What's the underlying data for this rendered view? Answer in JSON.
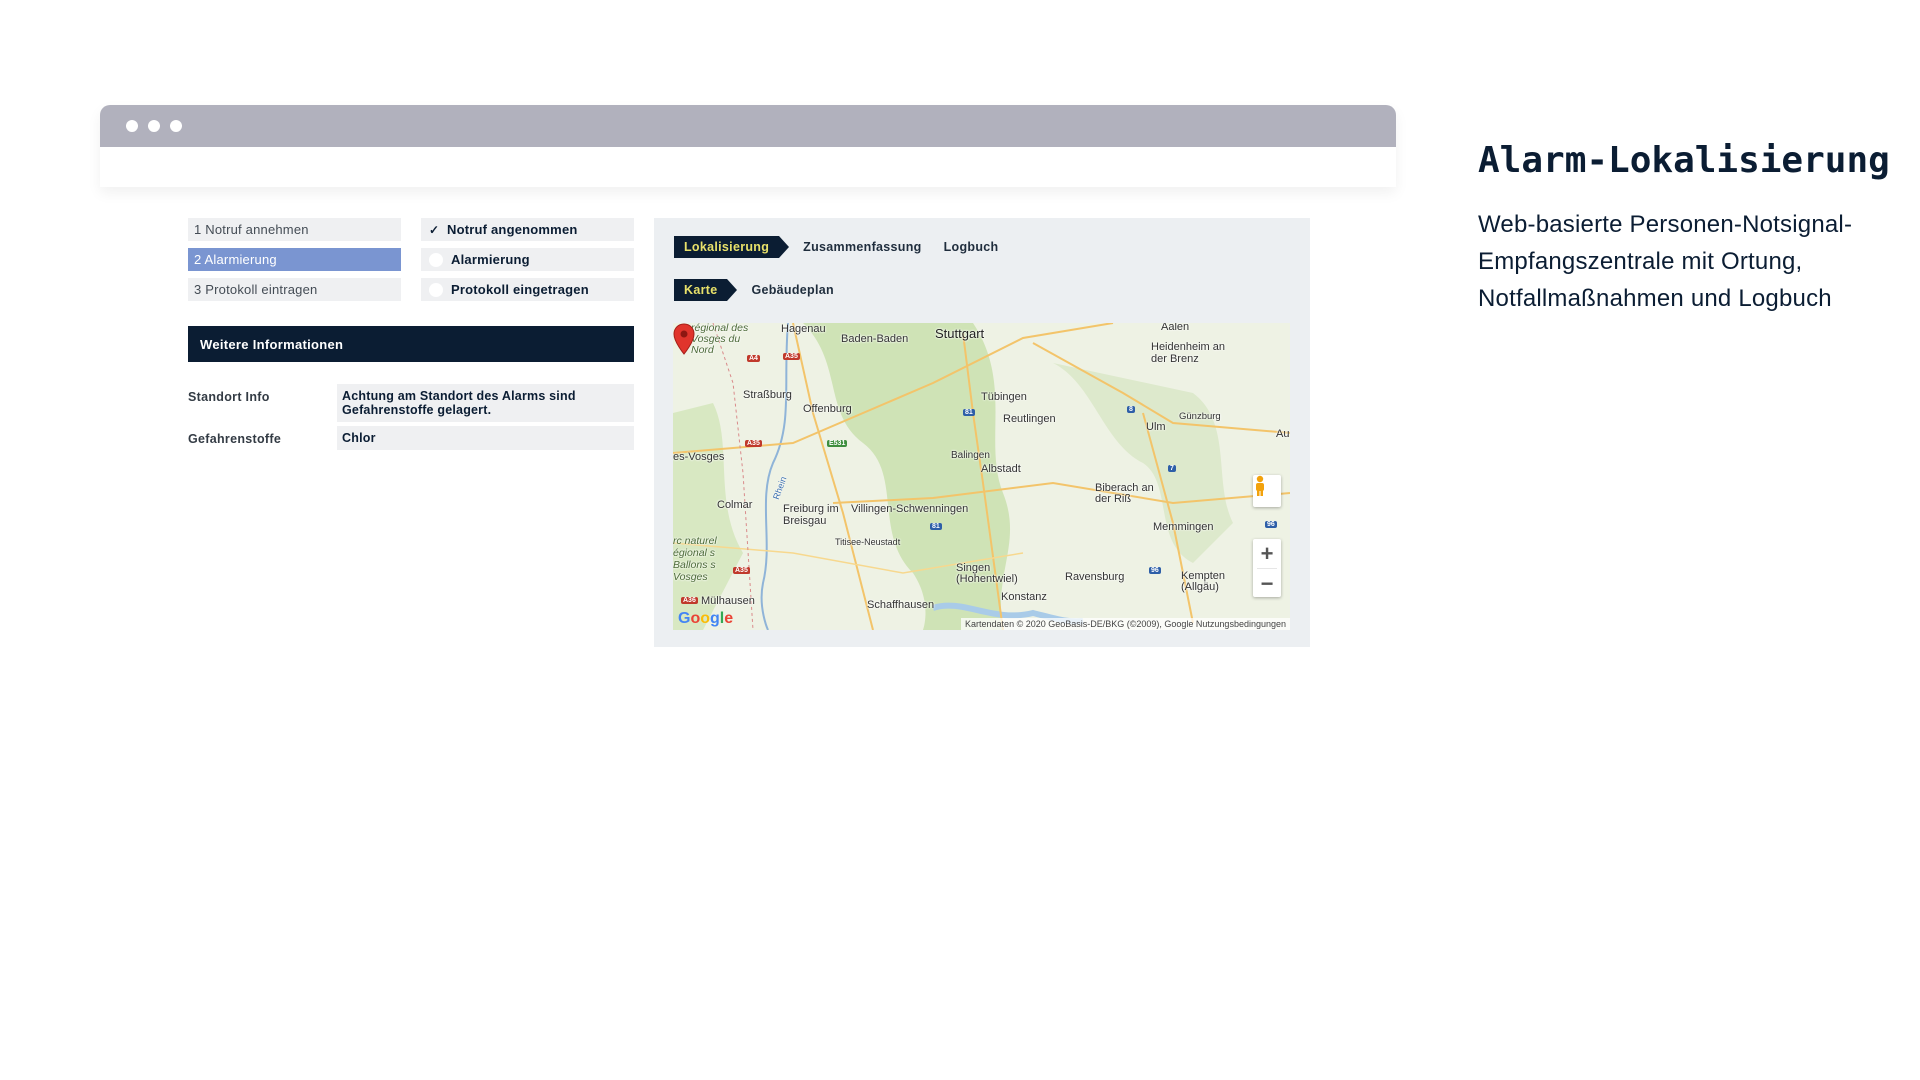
{
  "steps": [
    {
      "label": "1 Notruf annehmen",
      "status_label": "Notruf angenommen",
      "status": "done",
      "active": false
    },
    {
      "label": "2 Alarmierung",
      "status_label": "Alarmierung",
      "status": "pending",
      "active": true
    },
    {
      "label": "3 Protokoll eintragen",
      "status_label": "Protokoll eingetragen",
      "status": "pending",
      "active": false
    }
  ],
  "info": {
    "header": "Weitere Informationen",
    "fields": [
      {
        "label": "Standort Info",
        "value": "Achtung am Standort des Alarms sind Gefahrenstoffe gelagert."
      },
      {
        "label": "Gefahrenstoffe",
        "value": "Chlor"
      }
    ]
  },
  "tabs_main": {
    "active": "Lokalisierung",
    "others": [
      "Zusammenfassung",
      "Logbuch"
    ]
  },
  "tabs_sub": {
    "active": "Karte",
    "others": [
      "Gebäudeplan"
    ]
  },
  "map": {
    "labels": {
      "stuttgart": "Stuttgart",
      "baden_baden": "Baden-Baden",
      "hagenau": "Hagenau",
      "vosges_nord": "régional des Vosges du Nord",
      "aalen": "Aalen",
      "heidenheim": "Heidenheim an der Brenz",
      "strassburg": "Straßburg",
      "offenburg": "Offenburg",
      "tuebingen": "Tübingen",
      "reutlingen": "Reutlingen",
      "guenzburg": "Günzburg",
      "ulm": "Ulm",
      "au": "Au",
      "vosges": "es-Vosges",
      "balingen": "Balingen",
      "albstadt": "Albstadt",
      "biberach": "Biberach an der Riß",
      "colmar": "Colmar",
      "rhein": "Rhein",
      "freiburg": "Freiburg im Breisgau",
      "villingen": "Villingen-Schwenningen",
      "memmingen": "Memmingen",
      "titisee": "Titisee-Neustadt",
      "ballons": "rc naturel égional s Ballons s Vosges",
      "singen": "Singen (Hohentwiel)",
      "ravensburg": "Ravensburg",
      "kempten": "Kempten (Allgäu)",
      "muelhausen": "Mülhausen",
      "konstanz": "Konstanz",
      "schaffhausen": "Schaffhausen"
    },
    "google_logo": "Google",
    "attribution": "Kartendaten © 2020 GeoBasis-DE/BKG (©2009), Google   Nutzungsbedingungen",
    "zoom_in": "+",
    "zoom_out": "−"
  },
  "side": {
    "title": "Alarm-Lokalisierung",
    "description": "Web-basierte Personen-Notsignal-Empfangszentrale mit Ortung, Notfallmaßnahmen und Logbuch"
  }
}
